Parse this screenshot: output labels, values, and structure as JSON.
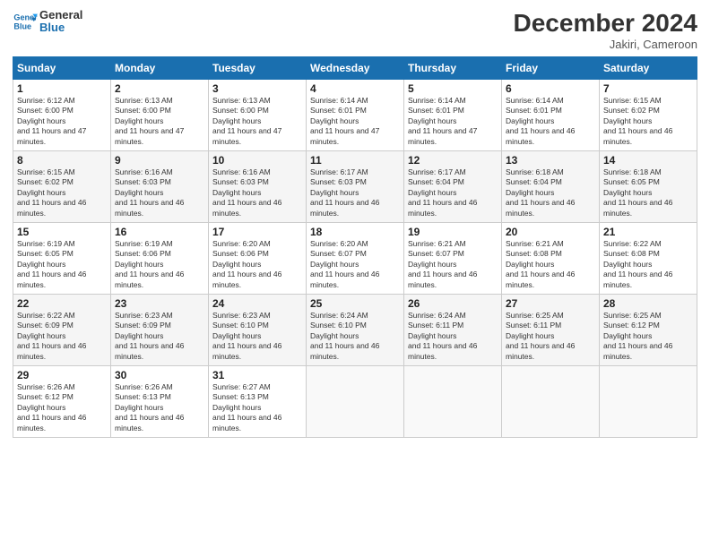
{
  "header": {
    "logo_line1": "General",
    "logo_line2": "Blue",
    "month_title": "December 2024",
    "location": "Jakiri, Cameroon"
  },
  "weekdays": [
    "Sunday",
    "Monday",
    "Tuesday",
    "Wednesday",
    "Thursday",
    "Friday",
    "Saturday"
  ],
  "weeks": [
    [
      {
        "day": "1",
        "rise": "6:12 AM",
        "set": "6:00 PM",
        "hours": "11 hours and 47 minutes."
      },
      {
        "day": "2",
        "rise": "6:13 AM",
        "set": "6:00 PM",
        "hours": "11 hours and 47 minutes."
      },
      {
        "day": "3",
        "rise": "6:13 AM",
        "set": "6:00 PM",
        "hours": "11 hours and 47 minutes."
      },
      {
        "day": "4",
        "rise": "6:14 AM",
        "set": "6:01 PM",
        "hours": "11 hours and 47 minutes."
      },
      {
        "day": "5",
        "rise": "6:14 AM",
        "set": "6:01 PM",
        "hours": "11 hours and 47 minutes."
      },
      {
        "day": "6",
        "rise": "6:14 AM",
        "set": "6:01 PM",
        "hours": "11 hours and 46 minutes."
      },
      {
        "day": "7",
        "rise": "6:15 AM",
        "set": "6:02 PM",
        "hours": "11 hours and 46 minutes."
      }
    ],
    [
      {
        "day": "8",
        "rise": "6:15 AM",
        "set": "6:02 PM",
        "hours": "11 hours and 46 minutes."
      },
      {
        "day": "9",
        "rise": "6:16 AM",
        "set": "6:03 PM",
        "hours": "11 hours and 46 minutes."
      },
      {
        "day": "10",
        "rise": "6:16 AM",
        "set": "6:03 PM",
        "hours": "11 hours and 46 minutes."
      },
      {
        "day": "11",
        "rise": "6:17 AM",
        "set": "6:03 PM",
        "hours": "11 hours and 46 minutes."
      },
      {
        "day": "12",
        "rise": "6:17 AM",
        "set": "6:04 PM",
        "hours": "11 hours and 46 minutes."
      },
      {
        "day": "13",
        "rise": "6:18 AM",
        "set": "6:04 PM",
        "hours": "11 hours and 46 minutes."
      },
      {
        "day": "14",
        "rise": "6:18 AM",
        "set": "6:05 PM",
        "hours": "11 hours and 46 minutes."
      }
    ],
    [
      {
        "day": "15",
        "rise": "6:19 AM",
        "set": "6:05 PM",
        "hours": "11 hours and 46 minutes."
      },
      {
        "day": "16",
        "rise": "6:19 AM",
        "set": "6:06 PM",
        "hours": "11 hours and 46 minutes."
      },
      {
        "day": "17",
        "rise": "6:20 AM",
        "set": "6:06 PM",
        "hours": "11 hours and 46 minutes."
      },
      {
        "day": "18",
        "rise": "6:20 AM",
        "set": "6:07 PM",
        "hours": "11 hours and 46 minutes."
      },
      {
        "day": "19",
        "rise": "6:21 AM",
        "set": "6:07 PM",
        "hours": "11 hours and 46 minutes."
      },
      {
        "day": "20",
        "rise": "6:21 AM",
        "set": "6:08 PM",
        "hours": "11 hours and 46 minutes."
      },
      {
        "day": "21",
        "rise": "6:22 AM",
        "set": "6:08 PM",
        "hours": "11 hours and 46 minutes."
      }
    ],
    [
      {
        "day": "22",
        "rise": "6:22 AM",
        "set": "6:09 PM",
        "hours": "11 hours and 46 minutes."
      },
      {
        "day": "23",
        "rise": "6:23 AM",
        "set": "6:09 PM",
        "hours": "11 hours and 46 minutes."
      },
      {
        "day": "24",
        "rise": "6:23 AM",
        "set": "6:10 PM",
        "hours": "11 hours and 46 minutes."
      },
      {
        "day": "25",
        "rise": "6:24 AM",
        "set": "6:10 PM",
        "hours": "11 hours and 46 minutes."
      },
      {
        "day": "26",
        "rise": "6:24 AM",
        "set": "6:11 PM",
        "hours": "11 hours and 46 minutes."
      },
      {
        "day": "27",
        "rise": "6:25 AM",
        "set": "6:11 PM",
        "hours": "11 hours and 46 minutes."
      },
      {
        "day": "28",
        "rise": "6:25 AM",
        "set": "6:12 PM",
        "hours": "11 hours and 46 minutes."
      }
    ],
    [
      {
        "day": "29",
        "rise": "6:26 AM",
        "set": "6:12 PM",
        "hours": "11 hours and 46 minutes."
      },
      {
        "day": "30",
        "rise": "6:26 AM",
        "set": "6:13 PM",
        "hours": "11 hours and 46 minutes."
      },
      {
        "day": "31",
        "rise": "6:27 AM",
        "set": "6:13 PM",
        "hours": "11 hours and 46 minutes."
      },
      null,
      null,
      null,
      null
    ]
  ]
}
